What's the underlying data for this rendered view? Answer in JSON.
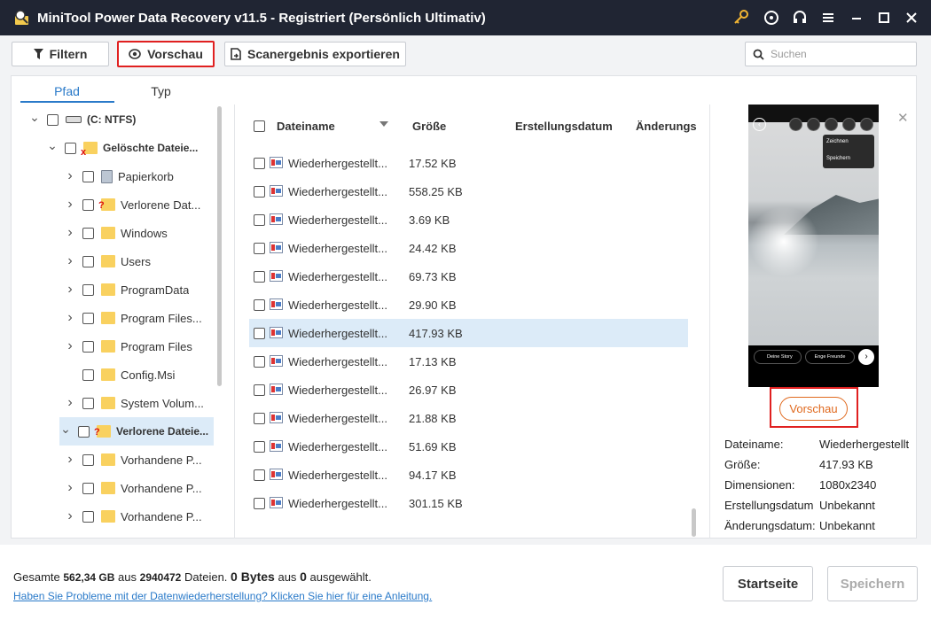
{
  "window": {
    "title": "MiniTool Power Data Recovery v11.5 - Registriert (Persönlich Ultimativ)"
  },
  "toolbar": {
    "filter_label": "Filtern",
    "preview_label": "Vorschau",
    "export_label": "Scanergebnis exportieren",
    "search_placeholder": "Suchen"
  },
  "tabs": [
    "Pfad",
    "Typ"
  ],
  "tree": [
    {
      "label": "(C: NTFS)",
      "expanded": true,
      "bold": true,
      "icon": "drive-icon"
    },
    {
      "label": "Gelöschte Dateie...",
      "expanded": true,
      "bold": true,
      "icon": "deleted-folder-icon"
    },
    {
      "label": "Papierkorb",
      "icon": "recycle-bin-icon"
    },
    {
      "label": "Verlorene Dat...",
      "icon": "lost-folder-icon"
    },
    {
      "label": "Windows",
      "icon": "folder-icon"
    },
    {
      "label": "Users",
      "icon": "folder-icon"
    },
    {
      "label": "ProgramData",
      "icon": "folder-icon"
    },
    {
      "label": "Program Files...",
      "icon": "folder-icon"
    },
    {
      "label": "Program Files",
      "icon": "folder-icon"
    },
    {
      "label": "Config.Msi",
      "icon": "folder-icon"
    },
    {
      "label": "System Volum...",
      "icon": "folder-icon"
    },
    {
      "label": "Verlorene Dateie...",
      "expanded": true,
      "bold": true,
      "selected": true,
      "icon": "lost-folder-icon"
    },
    {
      "label": "Vorhandene P...",
      "icon": "folder-icon"
    },
    {
      "label": "Vorhandene P...",
      "icon": "folder-icon"
    },
    {
      "label": "Vorhandene P...",
      "icon": "folder-icon"
    }
  ],
  "columns": {
    "name": "Dateiname",
    "size": "Größe",
    "created": "Erstellungsdatum",
    "modified": "Änderungs"
  },
  "files": [
    {
      "name": "Wiederhergestellt...",
      "size": "17.52 KB"
    },
    {
      "name": "Wiederhergestellt...",
      "size": "558.25 KB"
    },
    {
      "name": "Wiederhergestellt...",
      "size": "3.69 KB"
    },
    {
      "name": "Wiederhergestellt...",
      "size": "24.42 KB"
    },
    {
      "name": "Wiederhergestellt...",
      "size": "69.73 KB"
    },
    {
      "name": "Wiederhergestellt...",
      "size": "29.90 KB"
    },
    {
      "name": "Wiederhergestellt...",
      "size": "417.93 KB",
      "selected": true
    },
    {
      "name": "Wiederhergestellt...",
      "size": "17.13 KB"
    },
    {
      "name": "Wiederhergestellt...",
      "size": "26.97 KB"
    },
    {
      "name": "Wiederhergestellt...",
      "size": "21.88 KB"
    },
    {
      "name": "Wiederhergestellt...",
      "size": "51.69 KB"
    },
    {
      "name": "Wiederhergestellt...",
      "size": "94.17 KB"
    },
    {
      "name": "Wiederhergestellt...",
      "size": "301.15 KB"
    }
  ],
  "preview": {
    "thumb_labels": {
      "draw": "Zeichnen",
      "save": "Speichern",
      "story": "Deine Story",
      "friends": "Enge Freunde"
    },
    "button_label": "Vorschau",
    "details": [
      {
        "label": "Dateiname:",
        "value": "Wiederhergestellt"
      },
      {
        "label": "Größe:",
        "value": "417.93 KB"
      },
      {
        "label": "Dimensionen:",
        "value": "1080x2340"
      },
      {
        "label": "Erstellungsdatum",
        "value": "Unbekannt"
      },
      {
        "label": "Änderungsdatum:",
        "value": "Unbekannt"
      }
    ]
  },
  "footer": {
    "summary_prefix": "Gesamte",
    "total_size": "562,34 GB",
    "summary_mid": "aus",
    "total_files": "2940472",
    "summary_files": "Dateien.",
    "selected_size": "0 Bytes",
    "summary_aus": "aus",
    "selected_count": "0",
    "summary_end": "ausgewählt.",
    "help_link": "Haben Sie Probleme mit der Datenwiederherstellung? Klicken Sie hier für eine Anleitung.",
    "home_label": "Startseite",
    "save_label": "Speichern"
  },
  "colors": {
    "titlebar": "#202533",
    "accent": "#2a7ac9",
    "highlight": "#e02020",
    "preview_button": "#e0691e",
    "selected_row": "#dcebf8"
  }
}
